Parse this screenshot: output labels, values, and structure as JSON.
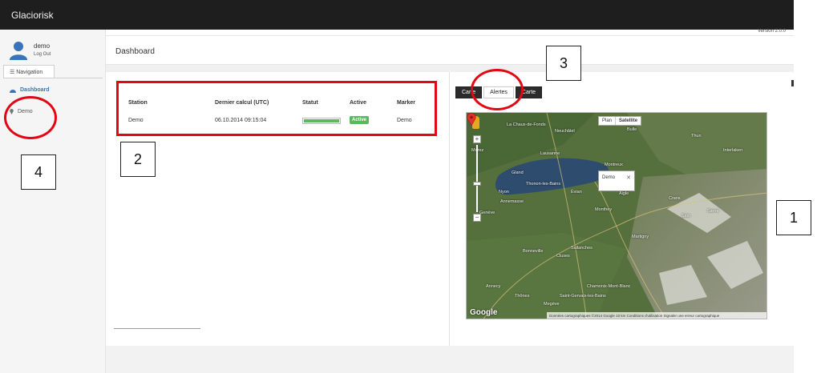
{
  "app": {
    "title": "Glaciorisk",
    "version": "Version 2.0.0"
  },
  "user": {
    "name": "demo",
    "logout": "Log Out"
  },
  "navigation": {
    "header": "Navigation",
    "items": [
      {
        "label": "Dashboard",
        "icon": "dashboard-icon",
        "active": true
      },
      {
        "label": "Demo",
        "icon": "map-marker-icon",
        "active": false
      }
    ]
  },
  "page": {
    "title": "Dashboard"
  },
  "stations_table": {
    "columns": [
      "Station",
      "Dernier calcul (UTC)",
      "Statut",
      "Active",
      "Marker"
    ],
    "rows": [
      {
        "station": "Demo",
        "last_calc": "06.10.2014 09:15:04",
        "status_progress": 1.0,
        "active": "Active",
        "marker": "Demo"
      }
    ]
  },
  "map_tabs": {
    "items": [
      "Carte",
      "Alertes",
      "Carte"
    ],
    "selected": 1
  },
  "map": {
    "type_buttons": [
      "Plan",
      "Satellite"
    ],
    "selected_type": "Satellite",
    "popup_label": "Demo",
    "footer": "Données cartographiques ©2014 Google  10 km  Conditions d'utilisation  Signaler une erreur cartographique",
    "logo": "Google",
    "place_labels": [
      "La Chaux-de-Fonds",
      "Neuchâtel",
      "Bulle",
      "Lausanne",
      "Thonon-les-Bains",
      "Annemasse",
      "Genève",
      "Bonneville",
      "Cluses",
      "Sallanches",
      "Chamonix-Mont-Blanc",
      "Saint-Gervais-les-Bains",
      "Montreux",
      "Aigle",
      "Monthey",
      "Martigny",
      "Sion",
      "Sierre",
      "Thun",
      "Interlaken",
      "Annecy",
      "Thônes",
      "Megève",
      "Morez",
      "Gland",
      "Nyon",
      "Évian",
      "Crans"
    ]
  },
  "annotations": {
    "callouts": [
      "1",
      "2",
      "3",
      "4"
    ]
  },
  "colors": {
    "topbar": "#1e1e1e",
    "accent": "#3a74b8",
    "success": "#5cb85c",
    "annotation_red": "#e30613"
  }
}
